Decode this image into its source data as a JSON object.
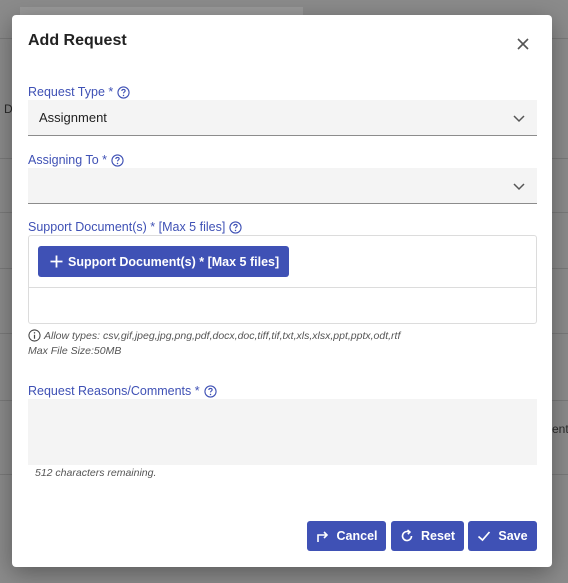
{
  "background": {
    "edge_text_left": "D",
    "edge_text_right": "ent"
  },
  "dialog": {
    "title": "Add Request",
    "close_icon": "close-icon",
    "request_type": {
      "label": "Request Type *",
      "value": "Assignment",
      "help_icon": "help-circle-icon",
      "dropdown_icon": "chevron-down-icon"
    },
    "assigning_to": {
      "label": "Assigning To *",
      "value": "",
      "help_icon": "help-circle-icon",
      "dropdown_icon": "chevron-down-icon"
    },
    "support_documents": {
      "label": "Support Document(s) * [Max 5 files]",
      "button_label": "Support Document(s) * [Max 5 files]",
      "button_icon": "plus-icon",
      "help_icon": "help-circle-icon",
      "allow_types": "Allow types: csv,gif,jpeg,jpg,png,pdf,docx,doc,tiff,tif,txt,xls,xlsx,ppt,pptx,odt,rtf",
      "max_file_size": "Max File Size:50MB",
      "info_icon": "info-icon"
    },
    "comments": {
      "label": "Request Reasons/Comments *",
      "value": "",
      "chars_remaining": "512 characters remaining.",
      "help_icon": "help-circle-icon"
    },
    "buttons": {
      "cancel": "Cancel",
      "reset": "Reset",
      "save": "Save"
    }
  },
  "colors": {
    "primary": "#3f51b5",
    "field_background": "#f4f4f4",
    "overlay": "#8b8b8b"
  }
}
